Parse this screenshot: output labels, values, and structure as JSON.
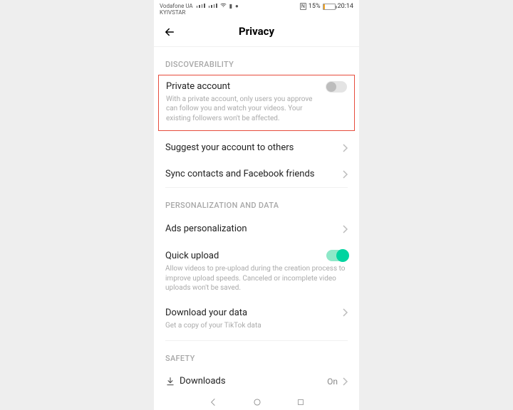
{
  "status": {
    "carrier1": "Vodafone UA",
    "carrier2": "KYIVSTAR",
    "battery_pct": "15%",
    "time": "20:14"
  },
  "header": {
    "title": "Privacy"
  },
  "sections": {
    "discoverability": {
      "header": "DISCOVERABILITY",
      "private_account": {
        "title": "Private account",
        "desc": "With a private account, only users you approve can follow you and watch your videos. Your existing followers won't be affected."
      },
      "suggest": {
        "title": "Suggest your account to others"
      },
      "sync": {
        "title": "Sync contacts and Facebook friends"
      }
    },
    "personalization": {
      "header": "PERSONALIZATION AND DATA",
      "ads": {
        "title": "Ads personalization"
      },
      "quick_upload": {
        "title": "Quick upload",
        "desc": "Allow videos to pre-upload during the creation process to improve upload speeds. Canceled or incomplete video uploads won't be saved."
      },
      "download_data": {
        "title": "Download your data",
        "desc": "Get a copy of your TikTok data"
      }
    },
    "safety": {
      "header": "SAFETY",
      "downloads": {
        "title": "Downloads",
        "value": "On"
      }
    }
  }
}
